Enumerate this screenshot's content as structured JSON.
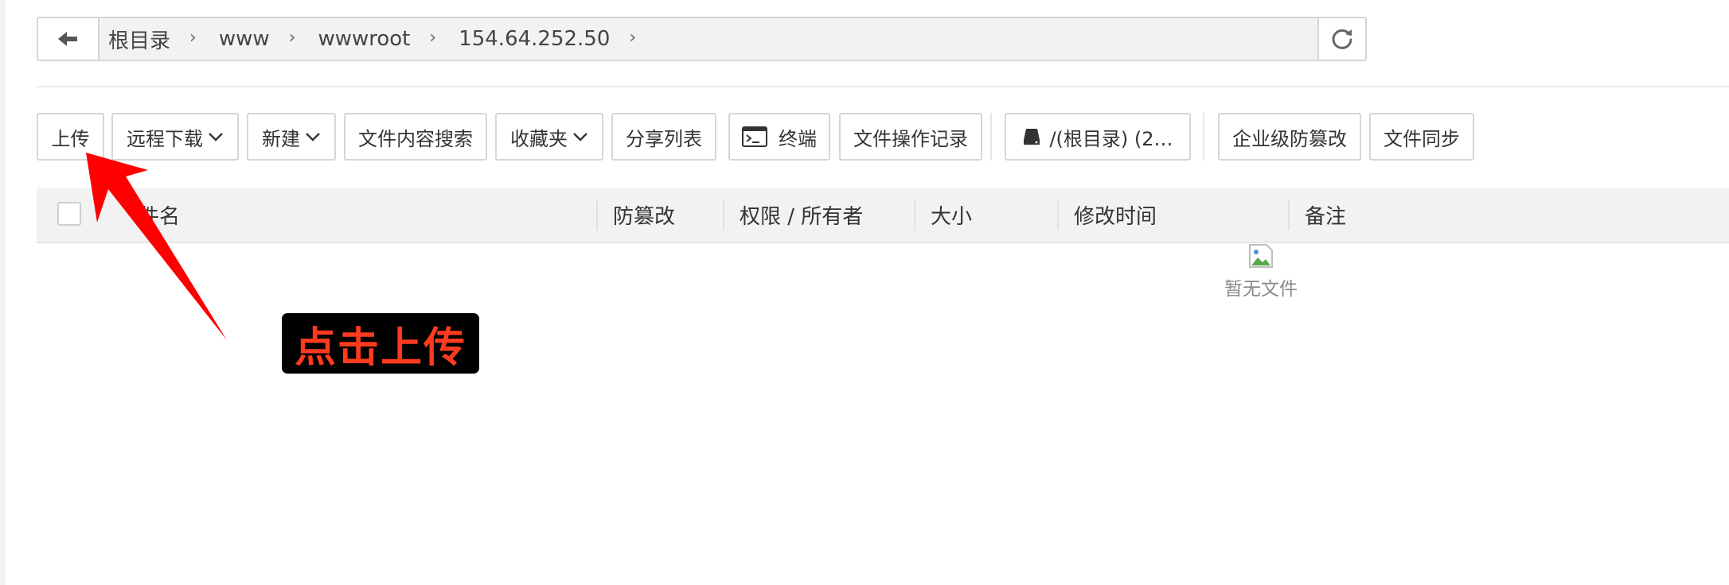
{
  "address_bar": {
    "breadcrumbs": [
      "根目录",
      "www",
      "wwwroot",
      "154.64.252.50"
    ]
  },
  "toolbar": {
    "upload": "上传",
    "remote_download": "远程下载",
    "new": "新建",
    "content_search": "文件内容搜索",
    "favorites": "收藏夹",
    "share_list": "分享列表",
    "terminal": "终端",
    "operation_log": "文件操作记录",
    "disk": "/(根目录) (2…",
    "tamper_proof": "企业级防篡改",
    "file_sync": "文件同步"
  },
  "table": {
    "columns": [
      "件名",
      "防篡改",
      "权限 / 所有者",
      "大小",
      "修改时间",
      "备注"
    ],
    "empty_text": "暂无文件"
  },
  "annotation": {
    "callout_text": "点击上传",
    "arrow_color": "#ff0000"
  },
  "colors": {
    "border": "#d6d6d6",
    "header_bg": "#f2f2f2",
    "callout_bg": "#000000",
    "callout_text": "#ff3b1f"
  }
}
